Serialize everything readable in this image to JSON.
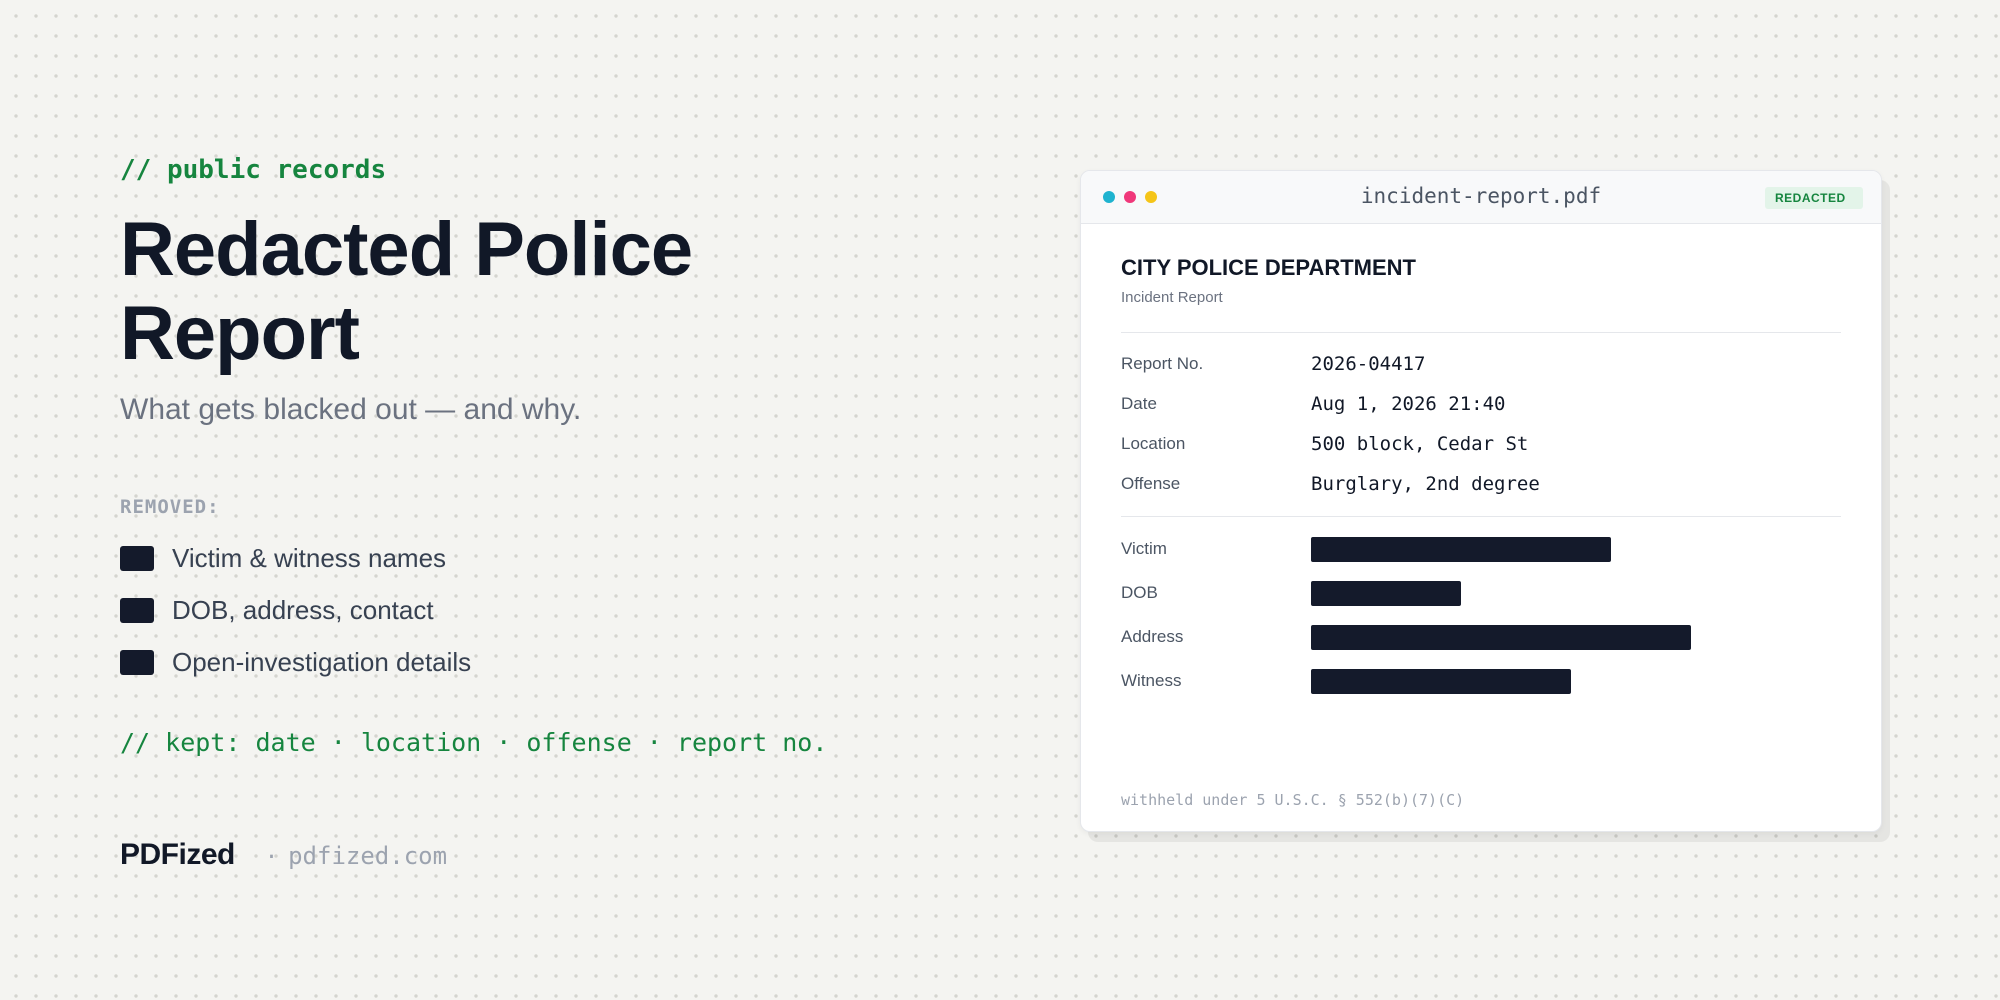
{
  "hero": {
    "eyebrow": "// public records",
    "title": "Redacted Police Report",
    "subtitle": "What gets blacked out — and why."
  },
  "removed": {
    "label": "REMOVED:",
    "items": [
      "Victim & witness names",
      "DOB, address, contact",
      "Open-investigation details"
    ]
  },
  "kept_note": "// kept: date · location · offense · report no.",
  "brand": {
    "name": "PDFized",
    "separator": "·",
    "url": "pdfized.com"
  },
  "document": {
    "file_name": "incident-report.pdf",
    "badge": "REDACTED",
    "window_dot_colors": [
      "#1fb3cf",
      "#f0387a",
      "#f5c518"
    ],
    "redaction_color": "#141a2b",
    "department": "CITY POLICE DEPARTMENT",
    "doc_type": "Incident Report",
    "fields": [
      {
        "label": "Report No.",
        "value": "2026-04417"
      },
      {
        "label": "Date",
        "value": "Aug 1, 2026 21:40"
      },
      {
        "label": "Location",
        "value": "500 block, Cedar St"
      },
      {
        "label": "Offense",
        "value": "Burglary, 2nd degree"
      }
    ],
    "redacted_fields": [
      {
        "label": "Victim"
      },
      {
        "label": "DOB"
      },
      {
        "label": "Address"
      },
      {
        "label": "Witness"
      }
    ],
    "legal_note": "withheld under 5 U.S.C. § 552(b)(7)(C)"
  }
}
